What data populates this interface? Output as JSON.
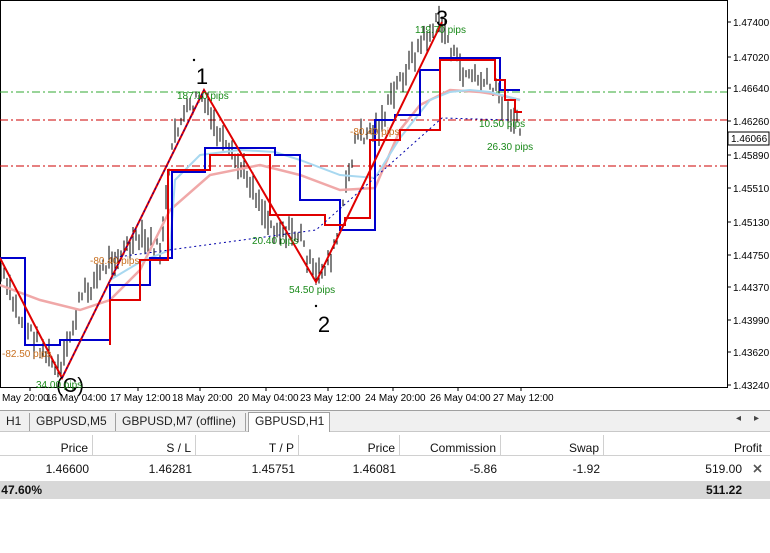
{
  "chart": {
    "symbol": "GBPUSD,H1",
    "current_price": "1.46066",
    "price_labels": [
      "1.47400",
      "1.47020",
      "1.46640",
      "1.46260",
      "1.45890",
      "1.45510",
      "1.45130",
      "1.44750",
      "1.44370",
      "1.43990",
      "1.43620",
      "1.43240"
    ],
    "time_labels": [
      "May 20:00",
      "16 May 04:00",
      "17 May 12:00",
      "18 May 20:00",
      "20 May 04:00",
      "23 May 12:00",
      "24 May 20:00",
      "26 May 04:00",
      "27 May 12:00"
    ],
    "wave_labels": [
      "1",
      "2",
      "3",
      "(C)"
    ],
    "pip_labels": [
      "187.10 pips",
      "119.70 pips",
      "10.50 pips",
      "26.30 pips",
      "20.40 pips",
      "54.50 pips",
      "-80.40 pips",
      "-82.50 pips",
      "34.00 pips",
      "-80.40 pips"
    ],
    "colors": {
      "up_wave": "#e00000",
      "signal_line": "#0000cc",
      "ma_light": "#a8d8f0",
      "ma_pink": "#f0a8a8",
      "hline_green": "#33aa33",
      "hline_red": "#cc0000",
      "pip_green": "#1a8a1a",
      "pip_orange": "#c87020"
    }
  },
  "tabs": {
    "items": [
      {
        "label": "H1"
      },
      {
        "label": "GBPUSD,M5"
      },
      {
        "label": "GBPUSD,M7 (offline)"
      },
      {
        "label": "GBPUSD,H1"
      }
    ],
    "active_index": 3,
    "prev_icon": "◂",
    "next_icon": "▸"
  },
  "orders": {
    "columns": [
      "Price",
      "S / L",
      "T / P",
      "Price",
      "Commission",
      "Swap",
      "Profit"
    ],
    "row": [
      "1.46600",
      "1.46281",
      "1.45751",
      "1.46081",
      "-5.86",
      "-1.92",
      "519.00"
    ],
    "row_close_icon": "close-icon",
    "total_left": "47.60%",
    "total_profit": "511.22"
  }
}
